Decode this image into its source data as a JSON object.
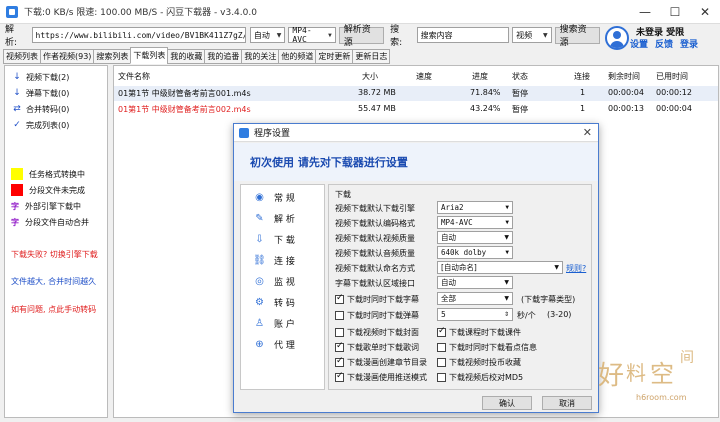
{
  "window": {
    "title": "下载:0 KB/s  限速: 100.00 MB/S  - 闪豆下载器  - v3.4.0.0",
    "controls": [
      "—",
      "☐",
      "✕"
    ]
  },
  "toolbar": {
    "parse_label": "解 析:",
    "url_value": "https://www.bilibili.com/video/BV1BK411Z7gZ/?spm_id_f",
    "mode_option": "自动",
    "codec_option": "MP4-AVC",
    "parse_button": "解析资源",
    "search_label": "搜 索:",
    "search_value": "搜索内容",
    "search_type": "视频",
    "search_button": "搜索资源"
  },
  "user": {
    "status": "未登录  受限",
    "links": [
      "设置",
      "反馈",
      "登录"
    ]
  },
  "tabs": [
    {
      "label": "视频列表"
    },
    {
      "label": "作者视频(93)"
    },
    {
      "label": "搜索列表"
    },
    {
      "label": "下载列表",
      "active": true
    },
    {
      "label": "我的收藏"
    },
    {
      "label": "我的追番"
    },
    {
      "label": "我的关注"
    },
    {
      "label": "他的频道"
    },
    {
      "label": "定时更新"
    },
    {
      "label": "更新日志"
    }
  ],
  "sidebar": {
    "items": [
      {
        "icon": "↓",
        "label": "视频下载(2)"
      },
      {
        "icon": "↓",
        "label": "弹幕下载(0)"
      },
      {
        "icon": "⇄",
        "label": "合并转码(0)"
      },
      {
        "icon": "✓",
        "label": "完成列表(0)"
      }
    ],
    "legend": [
      {
        "color": "#ffff00",
        "label": "任务格式转换中"
      },
      {
        "color": "#ff0000",
        "label": "分段文件未完成"
      },
      {
        "mark": "字",
        "label": "外部引擎下载中"
      },
      {
        "mark": "字",
        "label": "分段文件自动合并"
      }
    ],
    "notes": [
      "下载失败? 切换引擎下载",
      "文件越大, 合并时间越久",
      "如有问题, 点此手动转码"
    ]
  },
  "table": {
    "headers": [
      "文件名称",
      "大小",
      "速度",
      "进度",
      "状态",
      "连接",
      "剩余时间",
      "已用时间"
    ],
    "rows": [
      {
        "name": "01第1节 中级财管备考前言001.m4s",
        "size": "38.72 MB",
        "speed": "",
        "progress": "71.84%",
        "status": "暂停",
        "conn": "1",
        "remain": "00:00:04",
        "used": "00:00:12",
        "red": false
      },
      {
        "name": "01第1节 中级财管备考前言002.m4s",
        "size": "55.47 MB",
        "speed": "",
        "progress": "43.24%",
        "status": "暂停",
        "conn": "1",
        "remain": "00:00:13",
        "used": "00:00:04",
        "red": true
      }
    ]
  },
  "dialog": {
    "title": "程序设置",
    "banner": "初次使用 请先对下载器进行设置",
    "nav": [
      {
        "icon": "◉",
        "label": "常 规"
      },
      {
        "icon": "✎",
        "label": "解 析"
      },
      {
        "icon": "⇩",
        "label": "下 载"
      },
      {
        "icon": "⛓",
        "label": "连 接"
      },
      {
        "icon": "◎",
        "label": "监 视"
      },
      {
        "icon": "⚙",
        "label": "转 码"
      },
      {
        "icon": "♙",
        "label": "账 户"
      },
      {
        "icon": "⊕",
        "label": "代 理"
      }
    ],
    "group_title": "下载",
    "fields": [
      {
        "label": "视频下载默认下载引擎",
        "value": "Aria2"
      },
      {
        "label": "视频下载默认编码格式",
        "value": "MP4-AVC"
      },
      {
        "label": "视频下载默认视频质量",
        "value": "自动"
      },
      {
        "label": "视频下载默认音频质量",
        "value": "640k dolby"
      },
      {
        "label": "视频下载默认命名方式",
        "value": "[自动命名]"
      },
      {
        "label": "字幕下载默认区域接口",
        "value": "自动"
      }
    ],
    "naming_link": "规则?",
    "subtitle_check": {
      "label": "下载时同时下载字幕",
      "value": "全部",
      "note": "(下载字幕类型)",
      "checked": true
    },
    "danmaku_check": {
      "label": "下载时同时下载弹幕",
      "value": "5",
      "unit": "秒/个",
      "range": "(3-20)",
      "checked": false
    },
    "checks_left": [
      {
        "label": "下载视频时下载封面",
        "checked": false
      },
      {
        "label": "下载歌单时下载歌词",
        "checked": true
      },
      {
        "label": "下载漫画创建章节目录",
        "checked": true
      },
      {
        "label": "下载漫画使用推送模式",
        "checked": true
      }
    ],
    "checks_right": [
      {
        "label": "下载课程时下载课件",
        "checked": true
      },
      {
        "label": "下载时同时下载看点信息",
        "checked": false
      },
      {
        "label": "下载视频时投币收藏",
        "checked": false
      },
      {
        "label": "下载视频后校对MD5",
        "checked": false
      }
    ],
    "ok": "确认",
    "cancel": "取消"
  },
  "watermark": {
    "text": "好料空间",
    "url": "h6room.com"
  }
}
